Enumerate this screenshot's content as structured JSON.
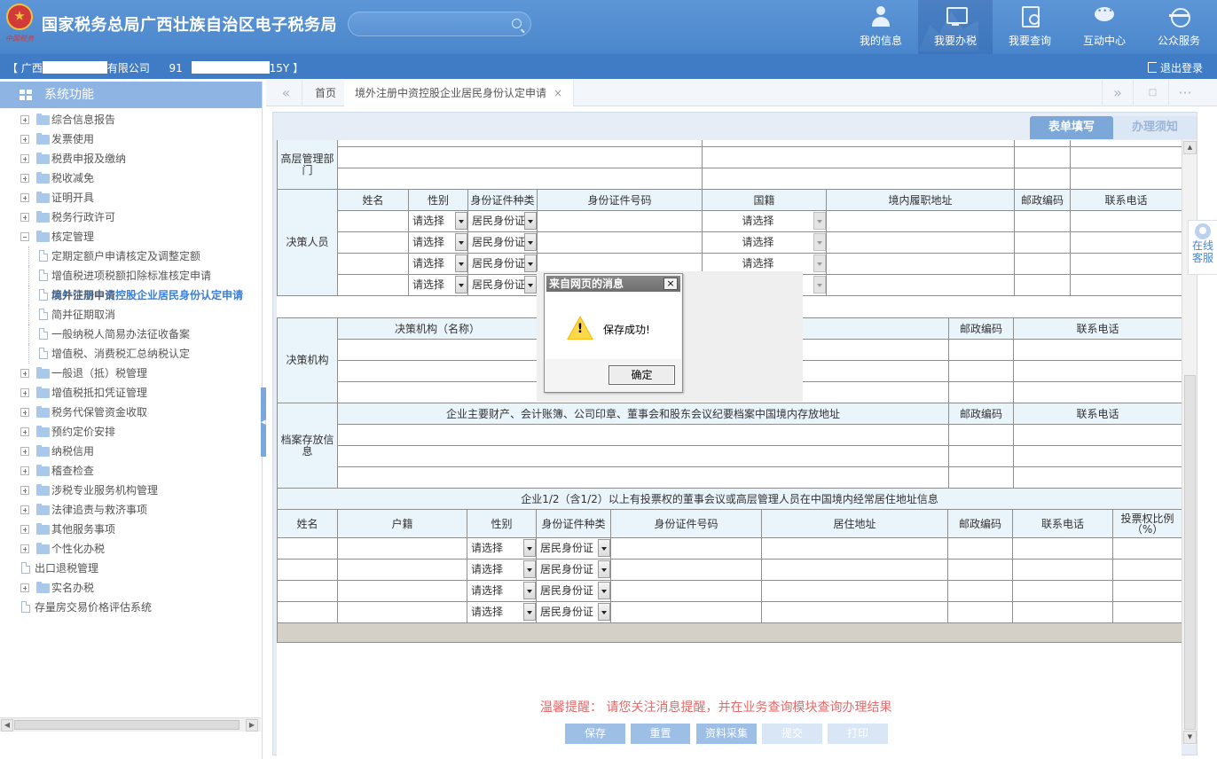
{
  "header": {
    "site_title": "国家税务总局广西壮族自治区电子税务局",
    "logo_caption": "中国税务",
    "nav": [
      {
        "label": "我的信息",
        "icon": "user-icon"
      },
      {
        "label": "我要办税",
        "icon": "monitor-icon"
      },
      {
        "label": "我要查询",
        "icon": "query-icon"
      },
      {
        "label": "互动中心",
        "icon": "chat-icon"
      },
      {
        "label": "公众服务",
        "icon": "service-icon"
      }
    ],
    "search_placeholder": ""
  },
  "infobar": {
    "bracket_open": "【",
    "company_prefix": "广西",
    "company_suffix": "有限公司",
    "taxid_prefix": "91",
    "taxid_suffix": "15Y",
    "bracket_close": "】",
    "logout": "退出登录"
  },
  "sidebar": {
    "title": "系统功能",
    "items": [
      {
        "label": "综合信息报告",
        "type": "folder",
        "expanded": false
      },
      {
        "label": "发票使用",
        "type": "folder",
        "expanded": false
      },
      {
        "label": "税费申报及缴纳",
        "type": "folder",
        "expanded": false
      },
      {
        "label": "税收减免",
        "type": "folder",
        "expanded": false
      },
      {
        "label": "证明开具",
        "type": "folder",
        "expanded": false
      },
      {
        "label": "税务行政许可",
        "type": "folder",
        "expanded": false
      },
      {
        "label": "核定管理",
        "type": "folder",
        "expanded": true
      },
      {
        "label": "定期定额户申请核定及调整定额",
        "type": "page",
        "level": 2
      },
      {
        "label": "增值税进项税额扣除标准核定申请",
        "type": "page",
        "level": 2
      },
      {
        "label": "境外注册中资控股企业居民身份认定申请",
        "type": "page",
        "level": 2,
        "selected": true
      },
      {
        "label": "简并征期申请",
        "type": "page",
        "level": 2
      },
      {
        "label": "简并征期取消",
        "type": "page",
        "level": 2
      },
      {
        "label": "一般纳税人简易办法征收备案",
        "type": "page",
        "level": 2
      },
      {
        "label": "增值税、消费税汇总纳税认定",
        "type": "page",
        "level": 2
      },
      {
        "label": "一般退（抵）税管理",
        "type": "folder",
        "expanded": false
      },
      {
        "label": "增值税抵扣凭证管理",
        "type": "folder",
        "expanded": false
      },
      {
        "label": "税务代保管资金收取",
        "type": "folder",
        "expanded": false
      },
      {
        "label": "预约定价安排",
        "type": "folder",
        "expanded": false
      },
      {
        "label": "纳税信用",
        "type": "folder",
        "expanded": false
      },
      {
        "label": "稽查检查",
        "type": "folder",
        "expanded": false
      },
      {
        "label": "涉税专业服务机构管理",
        "type": "folder",
        "expanded": false
      },
      {
        "label": "法律追责与救济事项",
        "type": "folder",
        "expanded": false
      },
      {
        "label": "其他服务事项",
        "type": "folder",
        "expanded": false
      },
      {
        "label": "个性化办税",
        "type": "folder",
        "expanded": false
      },
      {
        "label": "出口退税管理",
        "type": "page",
        "level": 1
      },
      {
        "label": "实名办税",
        "type": "folder",
        "expanded": false
      },
      {
        "label": "存量房交易价格评估系统",
        "type": "page",
        "level": 1
      }
    ]
  },
  "tabs": {
    "home": "首页",
    "active": "境外注册中资控股企业居民身份认定申请",
    "close": "×"
  },
  "form_tabs": {
    "fill": "表单填写",
    "notice": "办理须知"
  },
  "form": {
    "senior_mgmt_label": "高层管理部门",
    "decision_person_label": "决策人员",
    "person_headers": [
      "姓名",
      "性别",
      "身份证件种类",
      "身份证件号码",
      "国籍",
      "境内履职地址",
      "邮政编码",
      "联系电话"
    ],
    "gender_placeholder": "请选择",
    "id_type_value": "居民身份证",
    "nationality_placeholder": "请选择",
    "decision_org_label": "决策机构",
    "decision_org_headers": [
      "决策机构（名称）",
      "邮政编码",
      "联系电话"
    ],
    "archive_label": "档案存放信息",
    "archive_headers": [
      "企业主要财产、会计账簿、公司印章、董事会和股东会议纪要档案中国境内存放地址",
      "邮政编码",
      "联系电话"
    ],
    "residence_title": "企业1/2（含1/2）以上有投票权的董事会议或高层管理人员在中国境内经常居住地址信息",
    "residence_headers": [
      "姓名",
      "户籍",
      "性别",
      "身份证件种类",
      "身份证件号码",
      "居住地址",
      "邮政编码",
      "联系电话",
      "投票权比例（%）"
    ]
  },
  "dialog": {
    "title": "来自网页的消息",
    "message": "保存成功!",
    "ok": "确定",
    "close": "×"
  },
  "reminder": "温馨提醒：  请您关注消息提醒，并在业务查询模块查询办理结果",
  "actions": {
    "save": "保存",
    "reset": "重置",
    "collect": "资料采集",
    "submit": "提交",
    "print": "打印"
  },
  "customer_service": {
    "line1": "在线",
    "line2": "客服"
  },
  "colors": {
    "header": "#4a86cc",
    "infobar": "#3f7cc5",
    "selected_item": "#3b7fd8",
    "reminder": "#e46a6a",
    "table_header": "#eaf4fb"
  }
}
